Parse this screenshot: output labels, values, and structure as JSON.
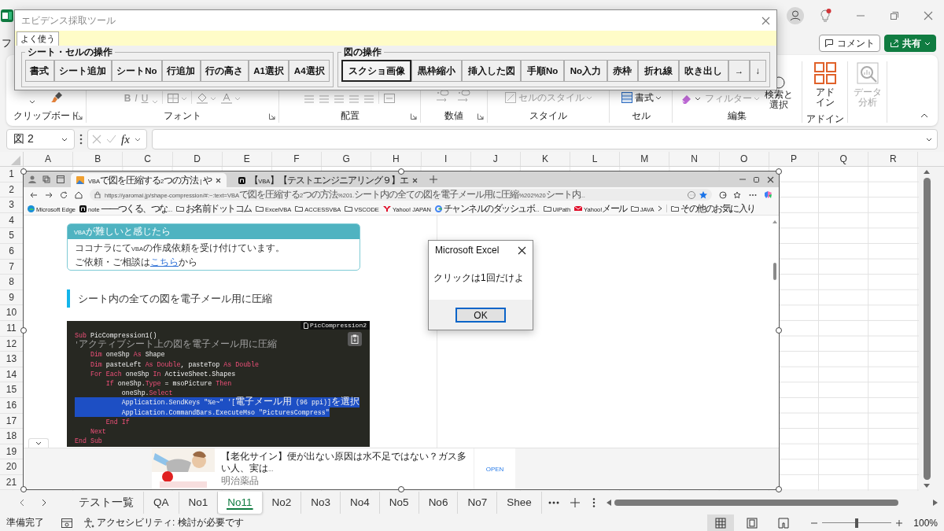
{
  "title_bar": {
    "file_tab": "フ",
    "comment_button": "コメント",
    "share_button": "共有"
  },
  "ribbon": {
    "groups": [
      {
        "label": "クリップボード"
      },
      {
        "label": "フォント",
        "buttons": [
          {
            "text": "B",
            "kind": "bold",
            "disabled": true
          },
          {
            "text": "I",
            "kind": "italic",
            "disabled": true
          },
          {
            "text": "U",
            "kind": "underline",
            "disabled": true
          }
        ]
      },
      {
        "label": "配置"
      },
      {
        "label": "数値"
      },
      {
        "label": "スタイル",
        "buttons": [
          {
            "text": "セルのスタイル",
            "kind": "plain",
            "disabled": true
          }
        ]
      },
      {
        "label": "セル",
        "buttons": [
          {
            "text": "書式",
            "kind": "plain",
            "disabled": false
          }
        ]
      },
      {
        "label": "編集",
        "buttons": [
          {
            "text": "フィルター",
            "kind": "plain",
            "disabled": true
          },
          {
            "text": "検索と選択",
            "kind": "plain",
            "disabled": false
          }
        ]
      },
      {
        "label": "アドイン",
        "buttons": [
          {
            "text": "アドイン",
            "kind": "plain",
            "disabled": false
          }
        ]
      },
      {
        "buttons": [
          {
            "text": "データ分析",
            "kind": "plain",
            "disabled": true
          }
        ]
      }
    ]
  },
  "tool_window": {
    "title": "エビデンス採取ツール",
    "tabs": [
      {
        "label": "よく使う",
        "selected": true
      }
    ],
    "groups": [
      {
        "title": "シート・セルの操作",
        "buttons": [
          {
            "label": "書式",
            "focused": false
          },
          {
            "label": "シート追加",
            "focused": false
          },
          {
            "label": "シートNo",
            "focused": false
          },
          {
            "label": "行追加",
            "focused": false
          },
          {
            "label": "行の高さ",
            "focused": false
          },
          {
            "label": "A1選択",
            "focused": false
          },
          {
            "label": "A4選択",
            "focused": false
          }
        ]
      },
      {
        "title": "図の操作",
        "buttons": [
          {
            "label": "スクショ画像",
            "focused": true
          },
          {
            "label": "黒枠縮小",
            "focused": false
          },
          {
            "label": "挿入した図",
            "focused": false
          },
          {
            "label": "手順No",
            "focused": false
          },
          {
            "label": "No入力",
            "focused": false
          },
          {
            "label": "赤枠",
            "focused": false
          },
          {
            "label": "折れ線",
            "focused": false
          },
          {
            "label": "吹き出し",
            "focused": false
          },
          {
            "label": "→",
            "focused": false
          },
          {
            "label": "↓",
            "focused": false
          }
        ]
      }
    ]
  },
  "formula_bar": {
    "name_box": "図 2",
    "function_label": "fx"
  },
  "sheet": {
    "columns": [
      "A",
      "B",
      "C",
      "D",
      "E",
      "F",
      "G",
      "H",
      "I",
      "J",
      "K",
      "L",
      "M",
      "N",
      "O",
      "P",
      "Q",
      "R"
    ],
    "rows": [
      "1",
      "2",
      "3",
      "4",
      "5",
      "6",
      "7",
      "8",
      "9",
      "10",
      "11",
      "12",
      "13",
      "14",
      "15",
      "16",
      "17",
      "18",
      "19",
      "20",
      "21"
    ]
  },
  "embedded_browser": {
    "tabs": [
      {
        "title": "VBAで図を圧縮する2つの方法 | や",
        "kind": "site",
        "selected": true
      },
      {
        "title": "【VBA】【テストエンジニアリング９】エ",
        "kind": "note",
        "selected": false
      }
    ],
    "url": "https://yaromai.jp/shape-compression/#:~:text=VBAで図を圧縮する2つの方法%201.シート内の全ての図を電子メール用に圧縮%202%20シート内...",
    "bookmarks": [
      {
        "label": "Microsoft Edge",
        "kind": "edge"
      },
      {
        "label": "note ——つくる、つな...",
        "kind": "note"
      },
      {
        "label": "お名前ドットコム",
        "kind": "folder"
      },
      {
        "label": "ExcelVBA",
        "kind": "folder"
      },
      {
        "label": "ACCESSVBA",
        "kind": "folder"
      },
      {
        "label": "VSCODE",
        "kind": "folder"
      },
      {
        "label": "Yahoo! JAPAN",
        "kind": "yahoo"
      },
      {
        "label": "チャンネルのダッシュボ...",
        "kind": "google"
      },
      {
        "label": "UiPath",
        "kind": "folder"
      },
      {
        "label": "Yahoo!メール",
        "kind": "mail"
      },
      {
        "label": "JAVA",
        "kind": "folder"
      }
    ],
    "other_favorites": "その他のお気に入り",
    "card": {
      "title": "VBAが難しいと感じたら",
      "text": "ココナラにてVBAの作成依頼を受け付けています。",
      "contact": {
        "before": "ご依頼・ご相談は",
        "link": "こちら",
        "after": "から"
      }
    },
    "heading": "シート内の全ての図を電子メール用に圧縮",
    "code": {
      "file_label": "PicCompression2",
      "lines": [
        {
          "selected": false,
          "tokens": [
            {
              "text": "Sub",
              "kind": "keyword"
            },
            {
              "text": " PicCompression1()",
              "kind": "plain"
            }
          ]
        },
        {
          "selected": false,
          "tokens": [
            {
              "text": "'アクティブシート上の図を電子メール用に圧縮",
              "kind": "comment"
            }
          ]
        },
        {
          "selected": false,
          "tokens": [
            {
              "text": "    Dim",
              "kind": "keyword"
            },
            {
              "text": " oneShp ",
              "kind": "plain"
            },
            {
              "text": "As",
              "kind": "keyword"
            },
            {
              "text": " Shape",
              "kind": "plain"
            }
          ]
        },
        {
          "selected": false,
          "tokens": [
            {
              "text": "    Dim",
              "kind": "keyword"
            },
            {
              "text": " pasteLeft ",
              "kind": "plain"
            },
            {
              "text": "As Double",
              "kind": "keyword"
            },
            {
              "text": ", pasteTop ",
              "kind": "plain"
            },
            {
              "text": "As Double",
              "kind": "keyword"
            }
          ]
        },
        {
          "selected": false,
          "tokens": [
            {
              "text": "    For Each",
              "kind": "keyword"
            },
            {
              "text": " oneShp ",
              "kind": "plain"
            },
            {
              "text": "In",
              "kind": "keyword"
            },
            {
              "text": " ActiveSheet.Shapes",
              "kind": "plain"
            }
          ]
        },
        {
          "selected": false,
          "tokens": [
            {
              "text": "        If",
              "kind": "keyword"
            },
            {
              "text": " oneShp.",
              "kind": "plain"
            },
            {
              "text": "Type",
              "kind": "keyword"
            },
            {
              "text": " = msoPicture ",
              "kind": "plain"
            },
            {
              "text": "Then",
              "kind": "keyword"
            }
          ]
        },
        {
          "selected": false,
          "tokens": [
            {
              "text": "            oneShp.",
              "kind": "plain"
            },
            {
              "text": "Select",
              "kind": "keyword"
            }
          ]
        },
        {
          "selected": true,
          "tokens": [
            {
              "text": "            Application.SendKeys \"%e~\" '[電子メール用 (96 ppi)]を選択",
              "kind": "plain"
            }
          ]
        },
        {
          "selected": true,
          "tokens": [
            {
              "text": "            Application.CommandBars.ExecuteMso \"PicturesCompress\"",
              "kind": "plain"
            }
          ]
        },
        {
          "selected": false,
          "tokens": [
            {
              "text": "        End If",
              "kind": "keyword"
            }
          ]
        },
        {
          "selected": false,
          "tokens": [
            {
              "text": "    Next",
              "kind": "keyword"
            }
          ]
        },
        {
          "selected": false,
          "tokens": [
            {
              "text": "End Sub",
              "kind": "keyword"
            }
          ]
        }
      ]
    },
    "ad": {
      "headline": "【老化サイン】便が出ない原因は水不足ではない？ガス多い人、実は...",
      "advertiser": "明治薬品",
      "action": "OPEN"
    }
  },
  "message_box": {
    "title": "Microsoft Excel",
    "message": "クリックは1回だけよ",
    "ok_button": {
      "label": "OK",
      "focused": true
    }
  },
  "sheet_tabs": [
    {
      "label": "テスト一覧",
      "selected": false
    },
    {
      "label": "QA",
      "selected": false
    },
    {
      "label": "No1",
      "selected": false
    },
    {
      "label": "No11",
      "selected": true
    },
    {
      "label": "No2",
      "selected": false
    },
    {
      "label": "No3",
      "selected": false
    },
    {
      "label": "No4",
      "selected": false
    },
    {
      "label": "No5",
      "selected": false
    },
    {
      "label": "No6",
      "selected": false
    },
    {
      "label": "No7",
      "selected": false
    },
    {
      "label": "Shee",
      "selected": false
    }
  ],
  "status_bar": {
    "status": "準備完了",
    "accessibility": "アクセシビリティ: 検討が必要です",
    "views": [
      {
        "kind": "normal",
        "selected": true
      },
      {
        "kind": "page-layout",
        "selected": false
      },
      {
        "kind": "page-break",
        "selected": false
      }
    ],
    "zoom_slider": {
      "level": 0.5
    },
    "zoom": "100%"
  }
}
